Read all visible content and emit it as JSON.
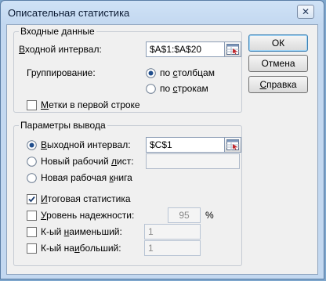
{
  "window": {
    "title": "Описательная статистика",
    "close_glyph": "✕"
  },
  "input_group": {
    "title": "Входные данные",
    "input_range_label_u": "В",
    "input_range_label_rest": "ходной интервал:",
    "input_range_value": "$A$1:$A$20",
    "grouping_label": "Группирование:",
    "by_columns_label": "по столбцам",
    "by_columns_u": "с",
    "by_rows_label_pre": "по ",
    "by_rows_u": "с",
    "by_rows_label_post": "трокам",
    "grouping_selected": "by_columns",
    "labels_first_row_label_u": "М",
    "labels_first_row_label_rest": "етки в первой строке",
    "labels_first_row_checked": false
  },
  "output_group": {
    "title": "Параметры вывода",
    "output_range_u": "В",
    "output_range_label_rest": "ыходной интервал:",
    "output_range_value": "$C$1",
    "new_sheet_label_pre": "Новый рабочий ",
    "new_sheet_u": "л",
    "new_sheet_label_post": "ист:",
    "new_sheet_value": "",
    "new_workbook_label_pre": "Новая рабочая ",
    "new_workbook_u": "к",
    "new_workbook_label_post": "нига",
    "output_selected": "output_range",
    "summary_stats_u": "И",
    "summary_stats_label_rest": "тоговая статистика",
    "summary_stats_checked": true,
    "confidence_u": "У",
    "confidence_label_rest": "ровень надежности:",
    "confidence_checked": false,
    "confidence_value": "95",
    "confidence_unit": "%",
    "kth_smallest_label_pre": "К-ый ",
    "kth_smallest_u": "н",
    "kth_smallest_label_post": "аименьший:",
    "kth_smallest_checked": false,
    "kth_smallest_value": "1",
    "kth_largest_label_pre": "К-ый на",
    "kth_largest_u": "и",
    "kth_largest_label_post": "больший:",
    "kth_largest_checked": false,
    "kth_largest_value": "1"
  },
  "buttons": {
    "ok": "ОК",
    "cancel": "Отмена",
    "help_u": "С",
    "help_rest": "правка"
  },
  "colors": {
    "accent": "#3c7fb1",
    "title_bar": "#c3d8f0"
  }
}
